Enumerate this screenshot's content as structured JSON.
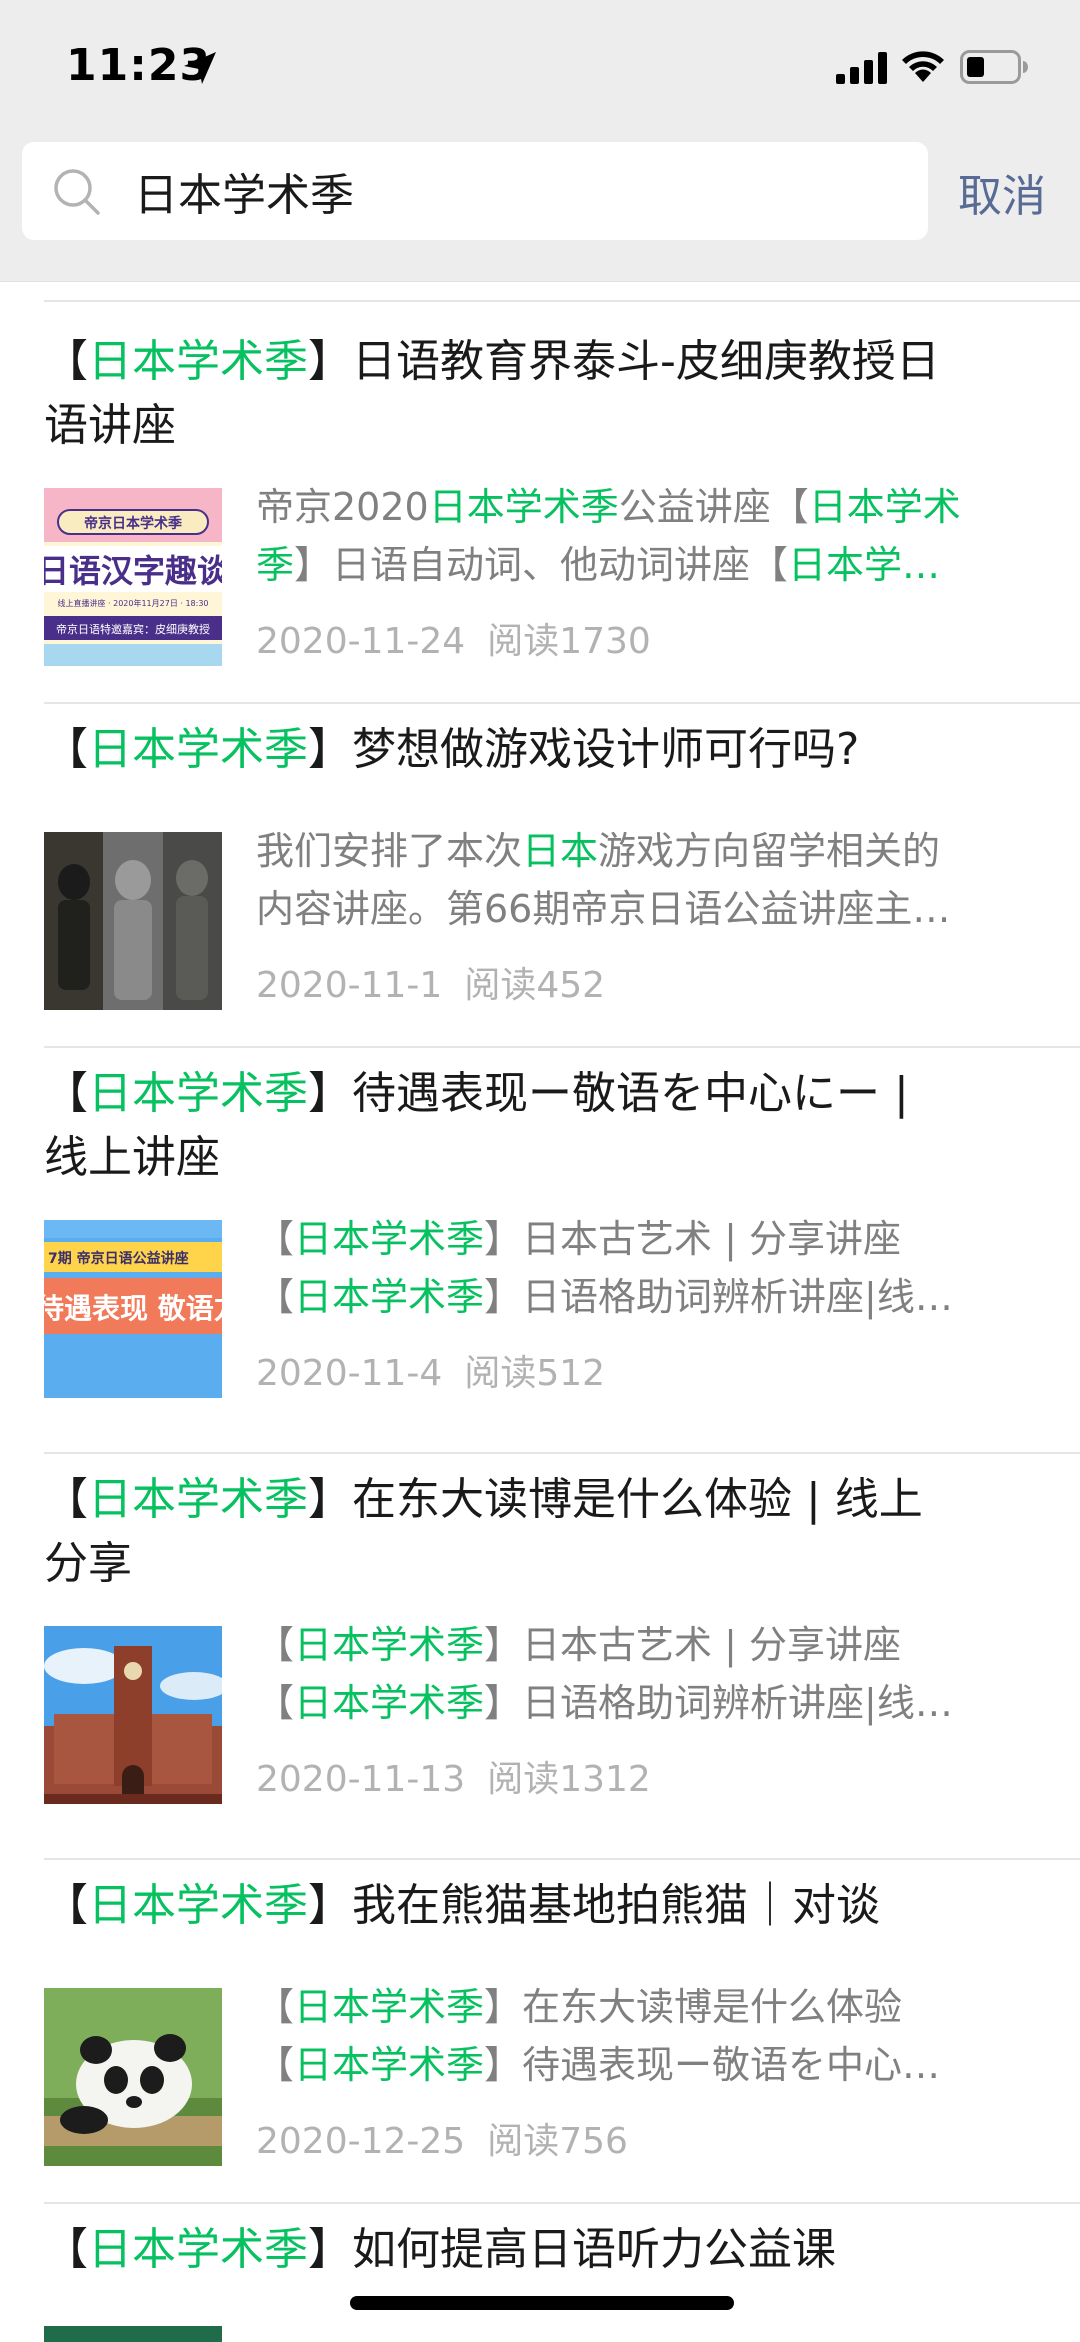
{
  "status": {
    "time": "11:23"
  },
  "search": {
    "value": "日本学术季",
    "cancel_label": "取消"
  },
  "articles": [
    {
      "title_tag_open": "【",
      "title_tag": "日本学术季",
      "title_tag_close": "】",
      "title_rest": "日语教育界泰斗-皮细庚教授日",
      "title_line2": "语讲座",
      "snip1_a": "帝京2020",
      "snip1_hl": "日本学术季",
      "snip1_b": "公益讲座【",
      "snip1_hl2": "日本学术",
      "snip2_hl": "季",
      "snip2_b": "】日语自动词、他动词讲座【",
      "snip2_hl2": "日本学…",
      "date": "2020-11-24",
      "reads": "阅读1730",
      "thumb_top": "帝京日本学术季",
      "thumb_mid": "日语汉字趣谈",
      "thumb_sub": "线上直播讲座 · 2020年11月27日 · 18:30",
      "thumb_bottom": "帝京日语特邀嘉宾：皮细庚教授"
    },
    {
      "title_tag_open": "【",
      "title_tag": "日本学术季",
      "title_tag_close": "】",
      "title_rest": "梦想做游戏设计师可行吗?",
      "snip1_a": "我们安排了本次",
      "snip1_hl": "日本",
      "snip1_b": "游戏方向留学相关的",
      "snip2": "内容讲座。第66期帝京日语公益讲座主…",
      "date": "2020-11-1",
      "reads": "阅读452"
    },
    {
      "title_tag_open": "【",
      "title_tag": "日本学术季",
      "title_tag_close": "】",
      "title_rest": "待遇表现ー敬语を中心にー |",
      "title_line2": "线上讲座",
      "snip1_open": "【",
      "snip1_hl": "日本学术季",
      "snip1_b": "】日本古艺术 | 分享讲座",
      "snip2_open": "【",
      "snip2_hl": "日本学术季",
      "snip2_b": "】日语格助词辨析讲座|线…",
      "date": "2020-11-4",
      "reads": "阅读512",
      "thumb_top": "7期 帝京日语公益讲座",
      "thumb_mid": "待遇表现 敬语方"
    },
    {
      "title_tag_open": "【",
      "title_tag": "日本学术季",
      "title_tag_close": "】",
      "title_rest": "在东大读博是什么体验 | 线上",
      "title_line2": "分享",
      "snip1_open": "【",
      "snip1_hl": "日本学术季",
      "snip1_b": "】日本古艺术 | 分享讲座",
      "snip2_open": "【",
      "snip2_hl": "日本学术季",
      "snip2_b": "】日语格助词辨析讲座|线…",
      "date": "2020-11-13",
      "reads": "阅读1312"
    },
    {
      "title_tag_open": "【",
      "title_tag": "日本学术季",
      "title_tag_close": "】",
      "title_rest": "我在熊猫基地拍熊猫｜对谈",
      "snip1_open": "【",
      "snip1_hl": "日本学术季",
      "snip1_b": "】在东大读博是什么体验",
      "snip2_open": "【",
      "snip2_hl": "日本学术季",
      "snip2_b": "】待遇表现ー敬语を中心…",
      "date": "2020-12-25",
      "reads": "阅读756"
    },
    {
      "title_tag_open": "【",
      "title_tag": "日本学术季",
      "title_tag_close": "】",
      "title_rest": "如何提高日语听力公益课"
    }
  ],
  "colors": {
    "highlight": "#07c160",
    "link": "#576b95",
    "meta": "#b2b2b2"
  }
}
